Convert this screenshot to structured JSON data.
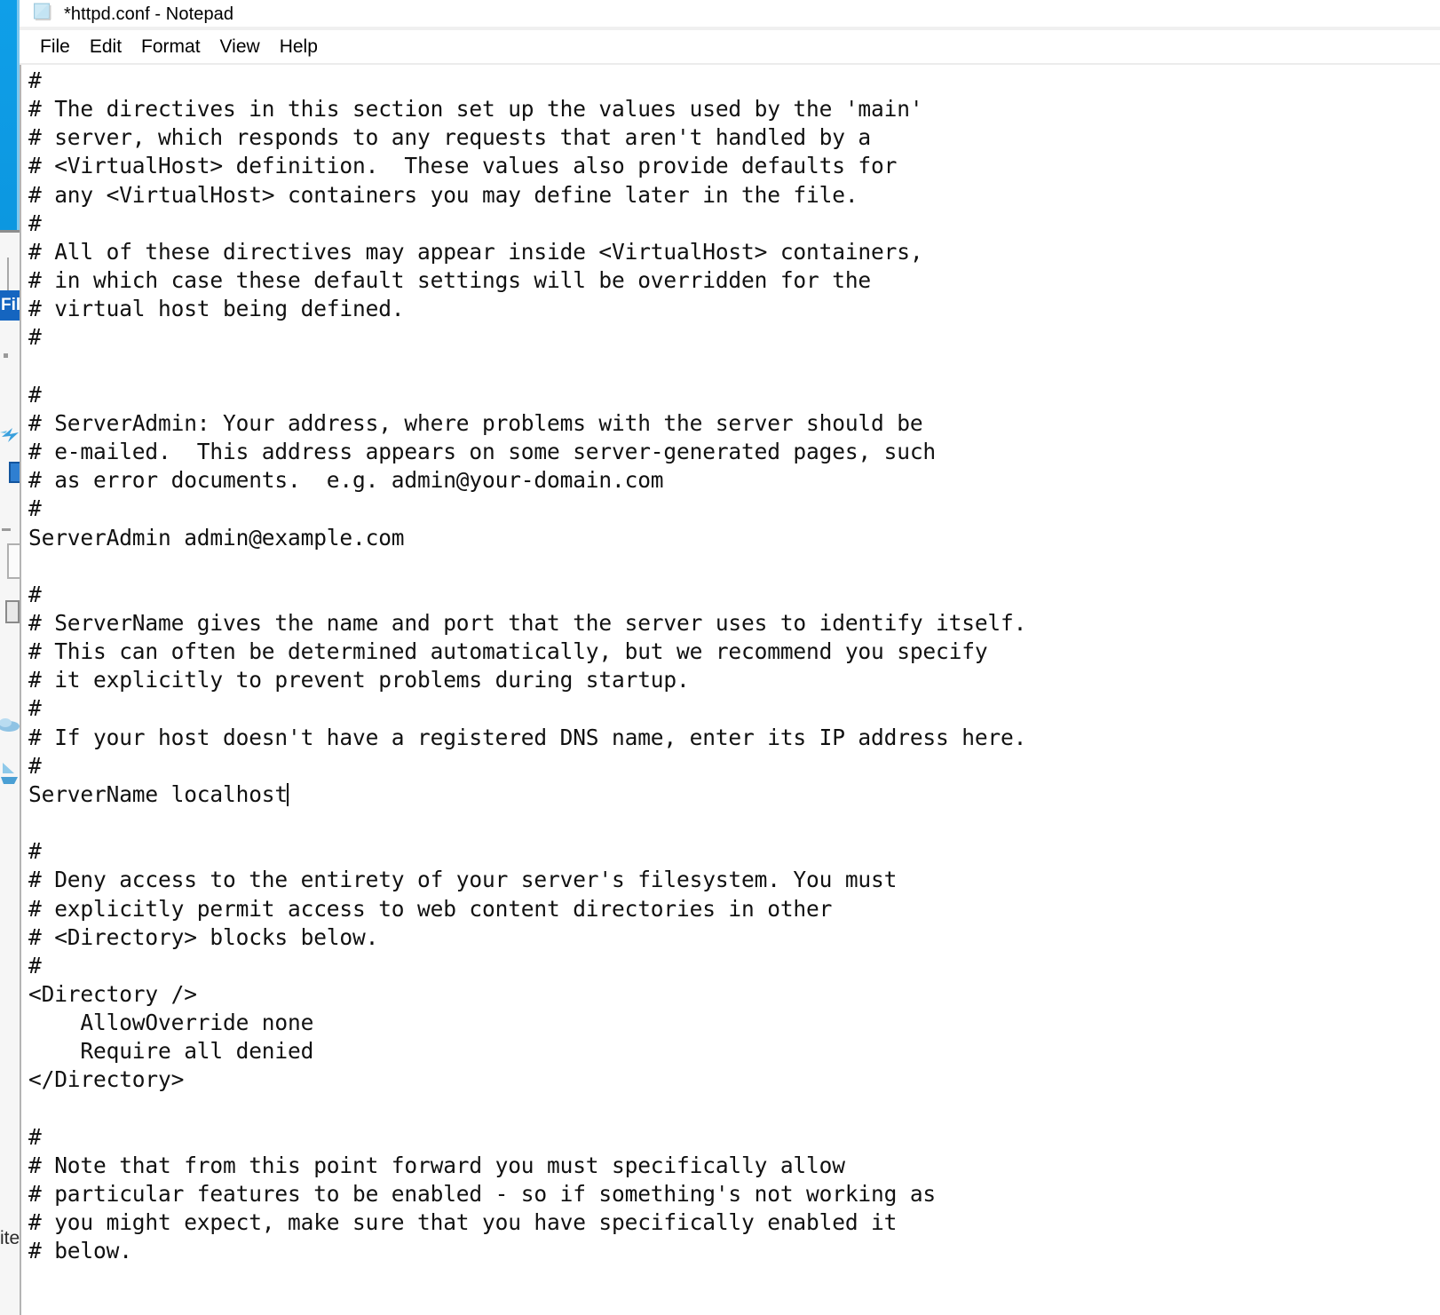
{
  "window": {
    "title": "*httpd.conf - Notepad",
    "icon": "notepad-document-icon",
    "menu": [
      "File",
      "Edit",
      "Format",
      "View",
      "Help"
    ]
  },
  "background": {
    "file_chip_label": "File",
    "bottom_text": "ite",
    "accent_color": "#0f9fe8",
    "chip_color": "#1565c0"
  },
  "editor": {
    "caret_after_line_index": 40,
    "lines": [
      "#",
      "# The directives in this section set up the values used by the 'main'",
      "# server, which responds to any requests that aren't handled by a",
      "# <VirtualHost> definition.  These values also provide defaults for",
      "# any <VirtualHost> containers you may define later in the file.",
      "#",
      "# All of these directives may appear inside <VirtualHost> containers,",
      "# in which case these default settings will be overridden for the",
      "# virtual host being defined.",
      "#",
      "",
      "#",
      "# ServerAdmin: Your address, where problems with the server should be",
      "# e-mailed.  This address appears on some server-generated pages, such",
      "# as error documents.  e.g. admin@your-domain.com",
      "#",
      "ServerAdmin admin@example.com",
      "",
      "#",
      "# ServerName gives the name and port that the server uses to identify itself.",
      "# This can often be determined automatically, but we recommend you specify",
      "# it explicitly to prevent problems during startup.",
      "#",
      "# If your host doesn't have a registered DNS name, enter its IP address here.",
      "#",
      "ServerName localhost",
      "",
      "#",
      "# Deny access to the entirety of your server's filesystem. You must",
      "# explicitly permit access to web content directories in other",
      "# <Directory> blocks below.",
      "#",
      "<Directory />",
      "    AllowOverride none",
      "    Require all denied",
      "</Directory>",
      "",
      "#",
      "# Note that from this point forward you must specifically allow",
      "# particular features to be enabled - so if something's not working as",
      "# you might expect, make sure that you have specifically enabled it",
      "# below."
    ],
    "caret_line": 25,
    "caret_visible": true
  }
}
